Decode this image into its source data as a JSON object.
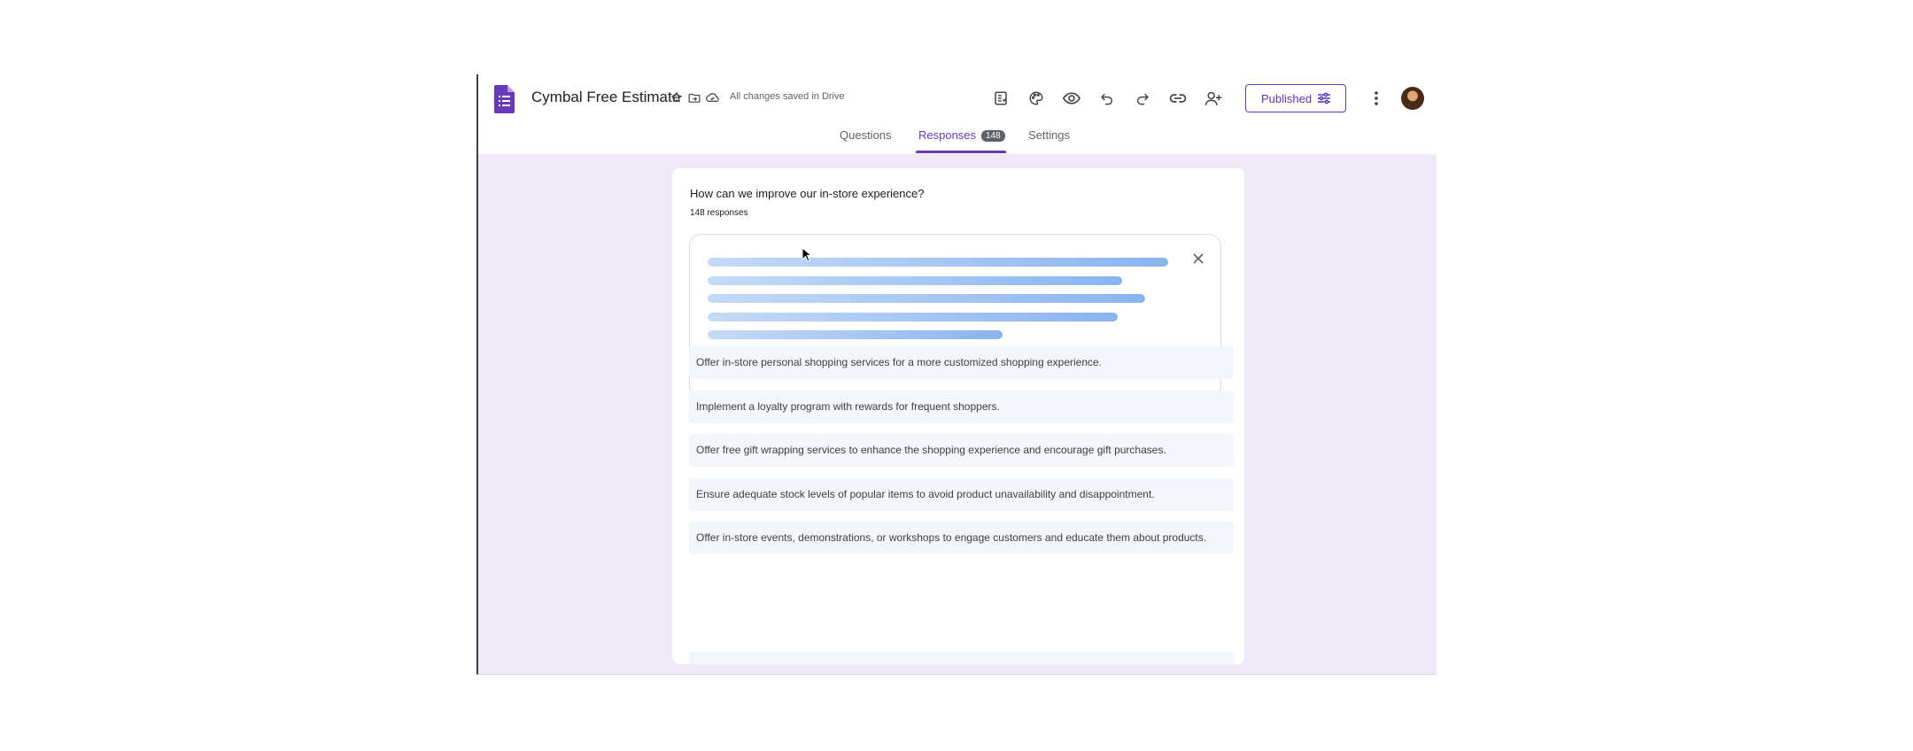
{
  "header": {
    "title": "Cymbal Free Estimate",
    "save_status": "All changes saved in Drive",
    "icons": [
      "forms-logo-icon",
      "star-icon",
      "move-to-folder-icon",
      "cloud-saved-icon",
      "addon-icon",
      "palette-icon",
      "preview-eye-icon",
      "undo-icon",
      "redo-icon",
      "link-icon",
      "add-collaborator-icon",
      "more-vert-icon",
      "avatar"
    ],
    "publish_button": "Published",
    "accent_color": "#673ab7"
  },
  "tabs": [
    {
      "label": "Questions",
      "active": false
    },
    {
      "label": "Responses",
      "active": true,
      "badge": "148"
    },
    {
      "label": "Settings",
      "active": false
    }
  ],
  "question": {
    "title": "How can we improve our in-store experience?",
    "response_count": "148 responses"
  },
  "summary_panel": {
    "state": "loading",
    "skeleton_line_fractions": [
      1.0,
      0.9,
      0.95,
      0.89,
      0.64,
      0.89,
      0.89
    ]
  },
  "responses": [
    "Offer in-store personal shopping services for a more customized shopping experience.",
    "Implement a loyalty program with rewards for frequent shoppers.",
    "Offer free gift wrapping services to enhance the shopping experience and encourage gift purchases.",
    "Ensure adequate stock levels of popular items to avoid product unavailability and disappointment.",
    "Offer in-store events, demonstrations, or workshops to engage customers and educate them about products."
  ]
}
